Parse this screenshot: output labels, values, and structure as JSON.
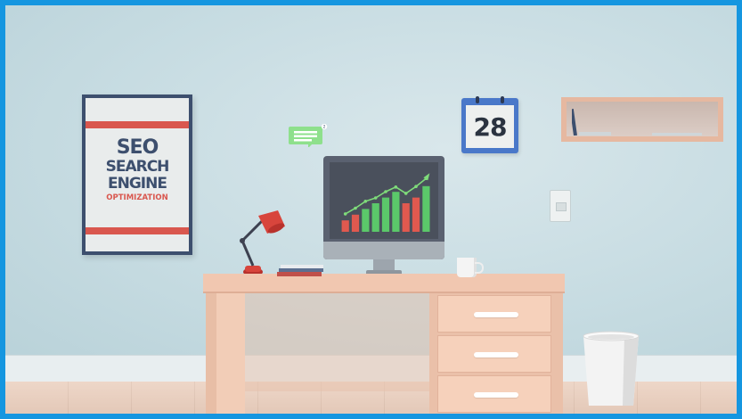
{
  "poster": {
    "line1": "SEO",
    "line2": "SEARCH",
    "line3": "ENGINE",
    "line4": "OPTIMIZATION"
  },
  "calendar": {
    "day": "28"
  },
  "bubble": {
    "badge": "2"
  },
  "chart_data": {
    "type": "bar",
    "values": [
      2,
      3,
      4,
      5,
      6,
      7,
      5,
      6,
      8
    ],
    "colors": [
      "#e0594f",
      "#e0594f",
      "#5bc86a",
      "#5bc86a",
      "#5bc86a",
      "#5bc86a",
      "#e0594f",
      "#e0594f",
      "#5bc86a"
    ],
    "trend": [
      2.2,
      3.2,
      4.4,
      5.0,
      6.1,
      6.9,
      5.8,
      7.0,
      8.4
    ],
    "ylim": [
      0,
      10
    ]
  },
  "colors": {
    "frame": "#1596e0",
    "wall": "#c7dce2",
    "desk": "#f1c7b0",
    "navy": "#3d4f6e",
    "red": "#d9574e",
    "calendar_blue": "#4a78c9"
  }
}
